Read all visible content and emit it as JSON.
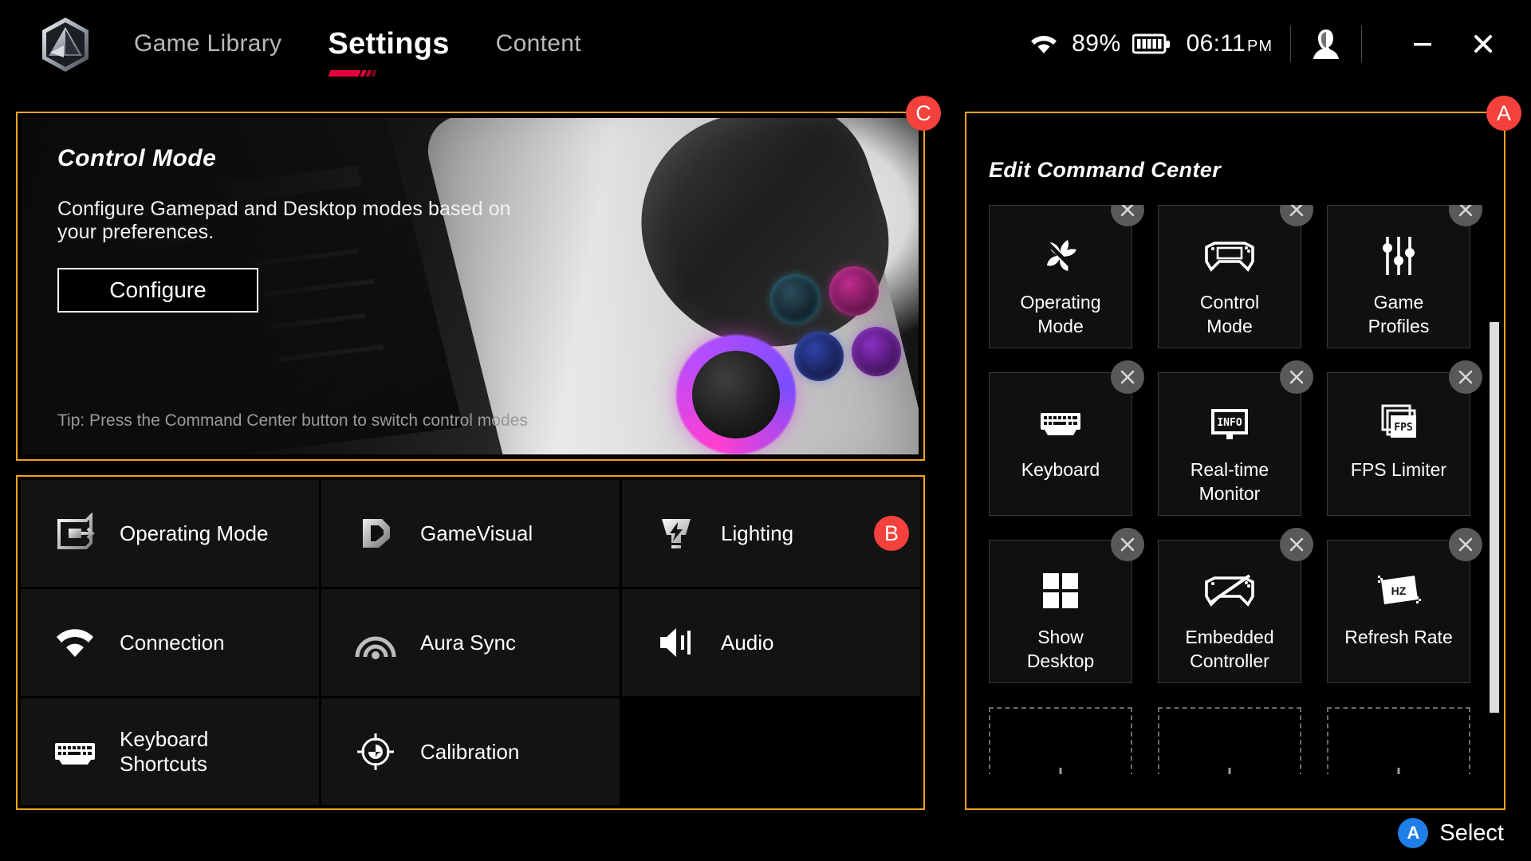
{
  "header": {
    "logo": "rog-hexagon-logo",
    "tabs": [
      {
        "label": "Game Library",
        "active": false
      },
      {
        "label": "Settings",
        "active": true
      },
      {
        "label": "Content",
        "active": false
      }
    ],
    "status": {
      "wifi_icon": "wifi-icon",
      "battery_percent": "89%",
      "battery_icon": "battery-full-icon",
      "time": "06:11",
      "time_period": "PM",
      "avatar_icon": "user-avatar-icon",
      "minimize_label": "—",
      "close_label": "✕"
    }
  },
  "hero": {
    "badge": "C",
    "title": "Control Mode",
    "description": "Configure Gamepad and Desktop modes based on your preferences.",
    "button_label": "Configure",
    "tip": "Tip: Press the Command Center button to switch control modes"
  },
  "settings_grid": {
    "badge": "B",
    "items": [
      {
        "label": "Operating Mode",
        "icon": "operating-mode-icon"
      },
      {
        "label": "GameVisual",
        "icon": "gamevisual-icon"
      },
      {
        "label": "Lighting",
        "icon": "lighting-icon",
        "badge": "B"
      },
      {
        "label": "Connection",
        "icon": "wifi-icon"
      },
      {
        "label": "Aura Sync",
        "icon": "aura-sync-icon"
      },
      {
        "label": "Audio",
        "icon": "audio-speaker-icon"
      },
      {
        "label": "Keyboard\nShortcuts",
        "icon": "keyboard-icon"
      },
      {
        "label": "Calibration",
        "icon": "calibration-target-icon"
      },
      {
        "label": "",
        "icon": ""
      }
    ]
  },
  "command_center": {
    "badge": "A",
    "title": "Edit Command Center",
    "remove_label": "✕",
    "add_label": "+",
    "tiles": [
      {
        "label": "Operating\nMode",
        "icon": "fan-operating-mode-icon",
        "removable": true
      },
      {
        "label": "Control\nMode",
        "icon": "gamepad-control-mode-icon",
        "removable": true
      },
      {
        "label": "Game\nProfiles",
        "icon": "sliders-game-profiles-icon",
        "removable": true
      },
      {
        "label": "Keyboard",
        "icon": "keyboard-icon",
        "removable": true
      },
      {
        "label": "Real-time\nMonitor",
        "icon": "info-monitor-icon",
        "removable": true
      },
      {
        "label": "FPS Limiter",
        "icon": "fps-stack-icon",
        "removable": true
      },
      {
        "label": "Show\nDesktop",
        "icon": "windows-squares-icon",
        "removable": true
      },
      {
        "label": "Embedded\nController",
        "icon": "gamepad-disabled-icon",
        "removable": true
      },
      {
        "label": "Refresh Rate",
        "icon": "hz-refresh-icon",
        "removable": true
      },
      {
        "label": "",
        "icon": "plus-add-icon",
        "add": true
      },
      {
        "label": "",
        "icon": "plus-add-icon",
        "add": true
      },
      {
        "label": "",
        "icon": "plus-add-icon",
        "add": true
      }
    ]
  },
  "footer": {
    "button_glyph": "A",
    "label": "Select"
  },
  "colors": {
    "panel_border": "#f0a31e",
    "badge_red": "#f4413c",
    "accent_red": "#e8003c",
    "select_blue": "#1f7fe8",
    "background": "#000000"
  }
}
